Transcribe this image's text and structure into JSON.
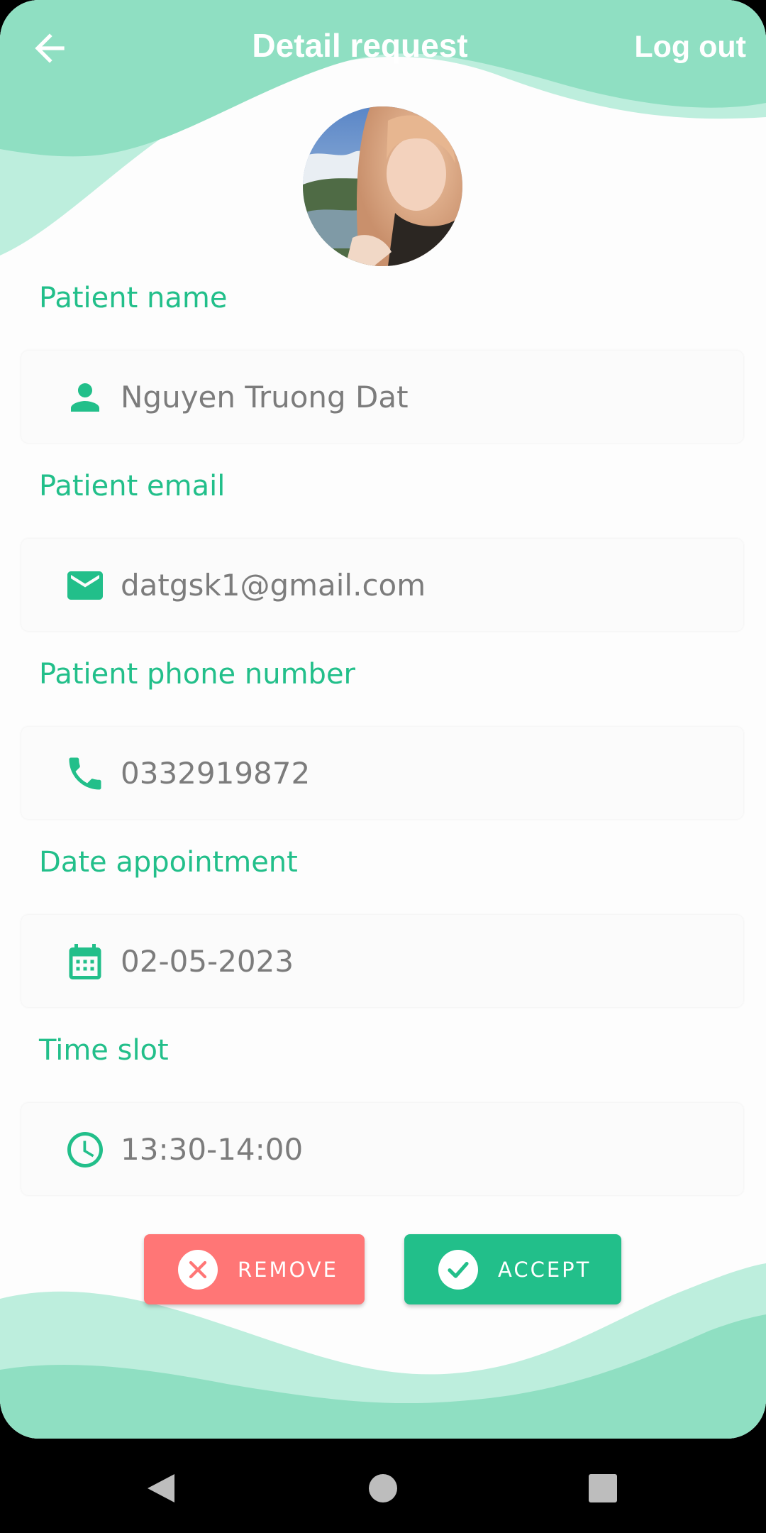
{
  "header": {
    "title": "Detail request",
    "logout_label": "Log out"
  },
  "avatar": {
    "icon": "patient-avatar-photo"
  },
  "fields": [
    {
      "label": "Patient name",
      "value": "Nguyen Truong Dat",
      "icon": "person-icon"
    },
    {
      "label": "Patient email",
      "value": "datgsk1@gmail.com",
      "icon": "email-icon"
    },
    {
      "label": "Patient phone number",
      "value": "0332919872",
      "icon": "phone-icon"
    },
    {
      "label": "Date appointment",
      "value": "02-05-2023",
      "icon": "calendar-icon"
    },
    {
      "label": "Time slot",
      "value": "13:30-14:00",
      "icon": "clock-icon"
    }
  ],
  "actions": {
    "remove_label": "REMOVE",
    "accept_label": "ACCEPT"
  },
  "colors": {
    "accent": "#22bf8a",
    "wave_dark": "#8fdfc2",
    "wave_light": "#bdeedd",
    "remove": "#ff7676",
    "value_text": "#7c7c7c"
  }
}
